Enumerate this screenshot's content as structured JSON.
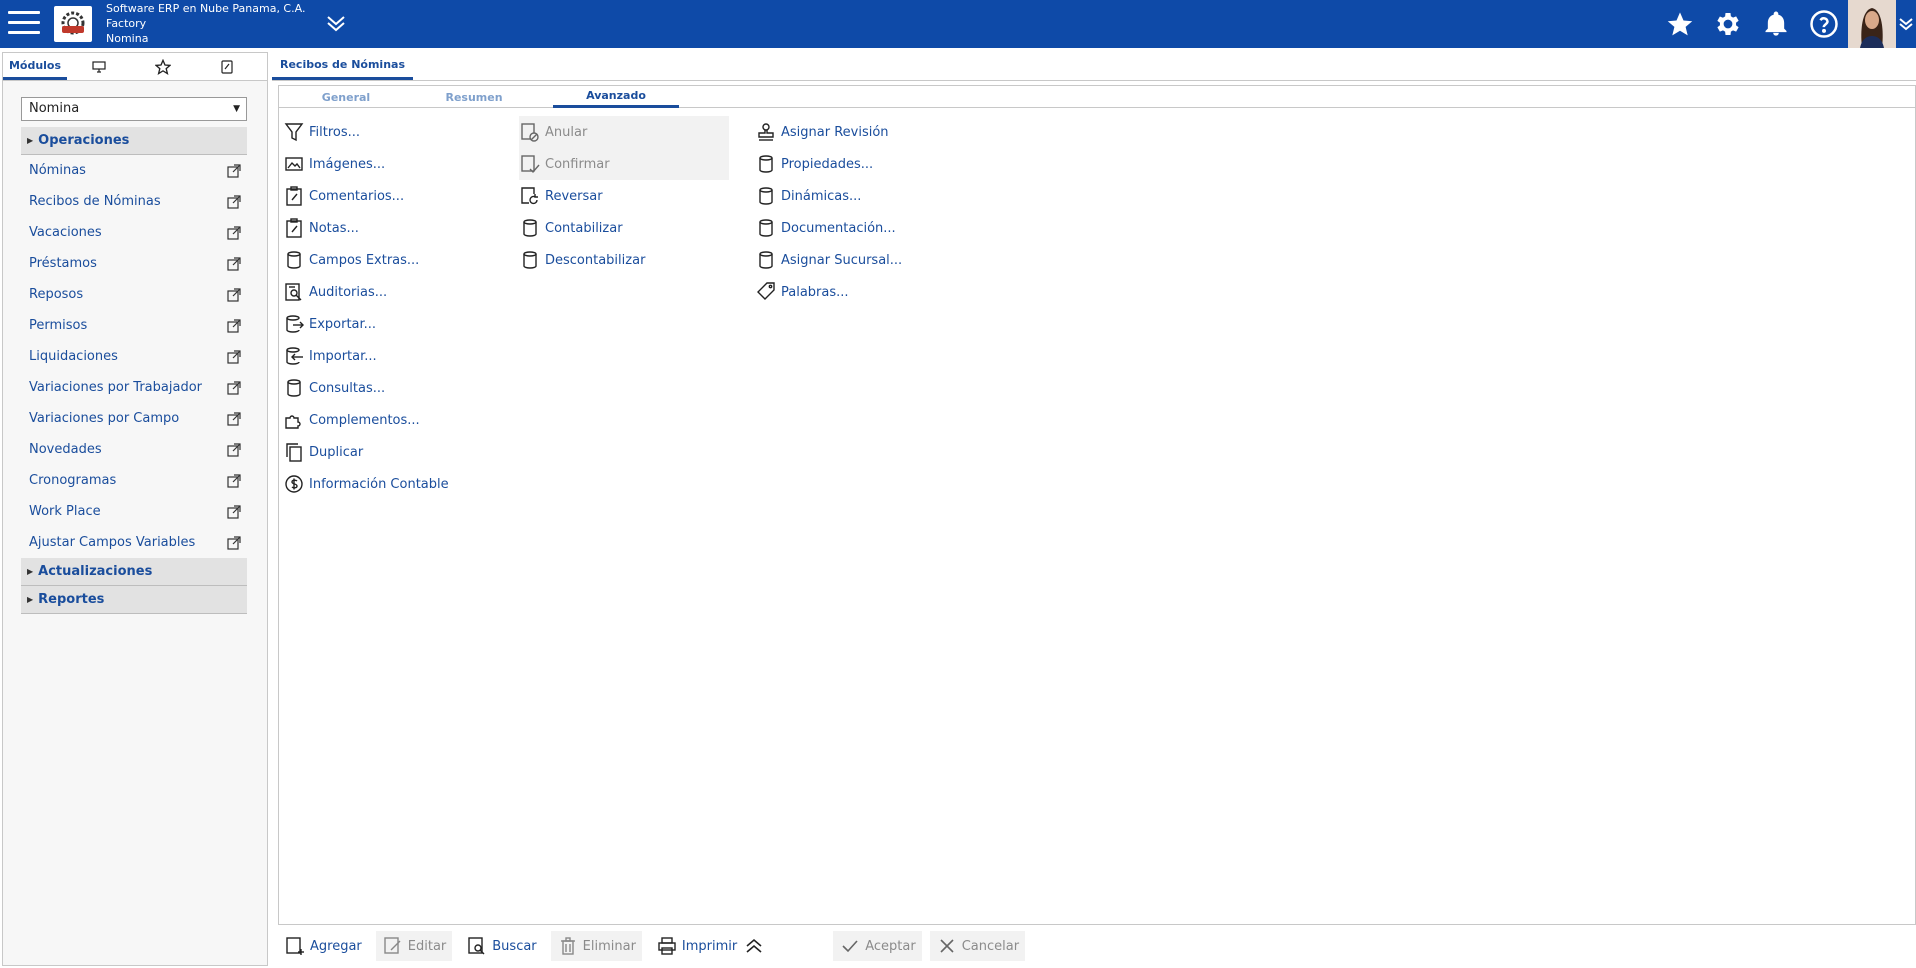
{
  "header": {
    "company_name": "Software ERP en Nube Panama, C.A.",
    "branch": "Factory",
    "module": "Nomina"
  },
  "left_panel": {
    "tabs": [
      {
        "label": "Módulos",
        "icon": null
      },
      {
        "label": "",
        "icon": "monitor-icon"
      },
      {
        "label": "",
        "icon": "star-outline-icon"
      },
      {
        "label": "",
        "icon": "document-edit-icon"
      }
    ],
    "module_select_value": "Nomina",
    "sections": {
      "operaciones": "Operaciones",
      "actualizaciones": "Actualizaciones",
      "reportes": "Reportes"
    },
    "menu_items": [
      "Nóminas",
      "Recibos de Nóminas",
      "Vacaciones",
      "Préstamos",
      "Reposos",
      "Permisos",
      "Liquidaciones",
      "Variaciones por Trabajador",
      "Variaciones por Campo",
      "Novedades",
      "Cronogramas",
      "Work Place",
      "Ajustar Campos Variables"
    ]
  },
  "document": {
    "tab_title": "Recibos de Nóminas",
    "sub_tabs": [
      "General",
      "Resumen",
      "Avanzado"
    ],
    "active_sub_tab": "Avanzado"
  },
  "actions": {
    "col1": [
      {
        "label": "Filtros...",
        "icon": "filter-icon"
      },
      {
        "label": "Imágenes...",
        "icon": "image-icon"
      },
      {
        "label": "Comentarios...",
        "icon": "clipboard-icon"
      },
      {
        "label": "Notas...",
        "icon": "clipboard-icon"
      },
      {
        "label": "Campos Extras...",
        "icon": "database-icon"
      },
      {
        "label": "Auditorias...",
        "icon": "audit-icon"
      },
      {
        "label": "Exportar...",
        "icon": "export-icon"
      },
      {
        "label": "Importar...",
        "icon": "import-icon"
      },
      {
        "label": "Consultas...",
        "icon": "database-icon"
      },
      {
        "label": "Complementos...",
        "icon": "puzzle-icon"
      },
      {
        "label": "Duplicar",
        "icon": "copy-icon"
      },
      {
        "label": "Información Contable",
        "icon": "dollar-icon"
      }
    ],
    "col2": [
      {
        "label": "Anular",
        "icon": "document-cancel-icon",
        "disabled": true
      },
      {
        "label": "Confirmar",
        "icon": "document-check-icon",
        "disabled": true
      },
      {
        "label": "Reversar",
        "icon": "document-revert-icon",
        "disabled": false
      },
      {
        "label": "Contabilizar",
        "icon": "database-icon",
        "disabled": false
      },
      {
        "label": "Descontabilizar",
        "icon": "database-icon",
        "disabled": false
      }
    ],
    "col3": [
      {
        "label": "Asignar Revisión",
        "icon": "stamp-icon"
      },
      {
        "label": "Propiedades...",
        "icon": "database-icon"
      },
      {
        "label": "Dinámicas...",
        "icon": "database-icon"
      },
      {
        "label": "Documentación...",
        "icon": "database-icon"
      },
      {
        "label": "Asignar Sucursal...",
        "icon": "database-icon"
      },
      {
        "label": "Palabras...",
        "icon": "tag-icon"
      }
    ]
  },
  "toolbar": {
    "add": "Agregar",
    "edit": "Editar",
    "search": "Buscar",
    "delete": "Eliminar",
    "print": "Imprimir",
    "accept": "Aceptar",
    "cancel": "Cancelar"
  },
  "colors": {
    "brand_blue": "#0e4aa8",
    "link_blue": "#1a4d9c",
    "disabled_gray": "#8b8b8b"
  }
}
